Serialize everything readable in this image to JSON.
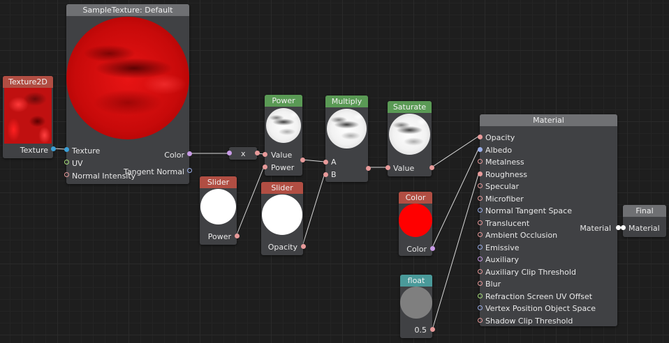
{
  "nodes": {
    "texture2d": {
      "title": "Texture2D",
      "out": "Texture"
    },
    "sample": {
      "title": "SampleTexture: Default",
      "inputs": [
        "Texture",
        "UV",
        "Normal Intensity"
      ],
      "outputs": [
        "Color",
        "Tangent Normal"
      ]
    },
    "multiply_x": {
      "label": "x"
    },
    "power": {
      "title": "Power",
      "inputs": [
        "Value",
        "Power"
      ]
    },
    "slider_power": {
      "title": "Slider",
      "out": "Power"
    },
    "slider_opacity": {
      "title": "Slider",
      "out": "Opacity"
    },
    "multiply": {
      "title": "Multiply",
      "inputs": [
        "A",
        "B"
      ]
    },
    "saturate": {
      "title": "Saturate",
      "in": "Value"
    },
    "color": {
      "title": "Color",
      "out": "Color",
      "swatch": "#ff0000"
    },
    "float": {
      "title": "float",
      "out": "0.5"
    },
    "material": {
      "title": "Material",
      "inputs": [
        "Opacity",
        "Albedo",
        "Metalness",
        "Roughness",
        "Specular",
        "Microfiber",
        "Normal Tangent Space",
        "Translucent",
        "Ambient Occlusion",
        "Emissive",
        "Auxiliary",
        "Auxiliary Clip Threshold",
        "Blur",
        "Refraction Screen UV Offset",
        "Vertex Position Object Space",
        "Shadow Clip Threshold"
      ],
      "output": "Material"
    },
    "final": {
      "title": "Final",
      "in": "Material"
    }
  },
  "colors": {
    "pin_float": "#e89a9a",
    "pin_color": "#c99be8",
    "pin_texture": "#3aa0d8",
    "pin_uv": "#a8e07a",
    "pin_normal": "#9aaee8",
    "wire": "#e8e8e8"
  }
}
